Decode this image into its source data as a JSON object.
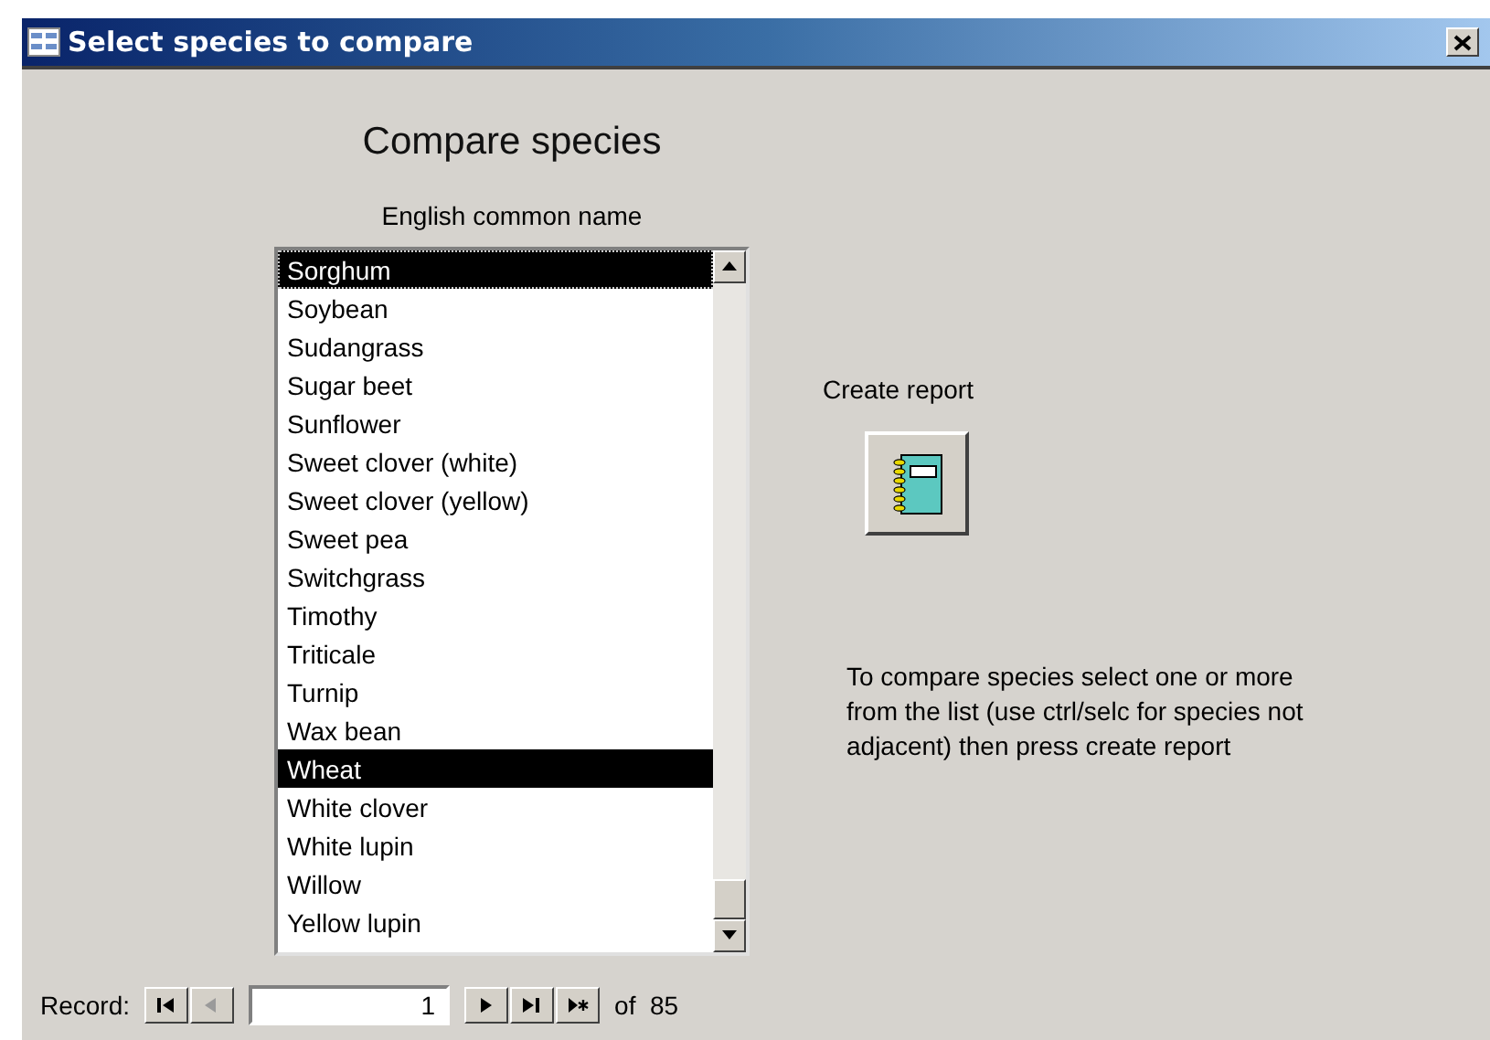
{
  "window": {
    "title": "Select species to compare"
  },
  "heading": "Compare species",
  "list": {
    "label": "English common name",
    "items": [
      {
        "text": "Sorghum",
        "selected": true,
        "focused": true
      },
      {
        "text": "Soybean",
        "selected": false,
        "focused": false
      },
      {
        "text": "Sudangrass",
        "selected": false,
        "focused": false
      },
      {
        "text": "Sugar beet",
        "selected": false,
        "focused": false
      },
      {
        "text": "Sunflower",
        "selected": false,
        "focused": false
      },
      {
        "text": "Sweet clover (white)",
        "selected": false,
        "focused": false
      },
      {
        "text": "Sweet clover (yellow)",
        "selected": false,
        "focused": false
      },
      {
        "text": "Sweet pea",
        "selected": false,
        "focused": false
      },
      {
        "text": "Switchgrass",
        "selected": false,
        "focused": false
      },
      {
        "text": "Timothy",
        "selected": false,
        "focused": false
      },
      {
        "text": "Triticale",
        "selected": false,
        "focused": false
      },
      {
        "text": "Turnip",
        "selected": false,
        "focused": false
      },
      {
        "text": "Wax bean",
        "selected": false,
        "focused": false
      },
      {
        "text": "Wheat",
        "selected": true,
        "focused": false
      },
      {
        "text": "White clover",
        "selected": false,
        "focused": false
      },
      {
        "text": "White lupin",
        "selected": false,
        "focused": false
      },
      {
        "text": "Willow",
        "selected": false,
        "focused": false
      },
      {
        "text": "Yellow lupin",
        "selected": false,
        "focused": false
      }
    ]
  },
  "create_report": {
    "label": "Create report"
  },
  "instructions": "To compare species select one or more from the list (use ctrl/selc for species not adjacent) then press create report",
  "record_nav": {
    "label": "Record:",
    "current": "1",
    "total": "of  85",
    "buttons": [
      {
        "kind": "first",
        "disabled": false
      },
      {
        "kind": "prev",
        "disabled": true
      }
    ],
    "buttons_after": [
      {
        "kind": "next",
        "disabled": false
      },
      {
        "kind": "last",
        "disabled": false
      },
      {
        "kind": "new",
        "disabled": false
      }
    ]
  }
}
